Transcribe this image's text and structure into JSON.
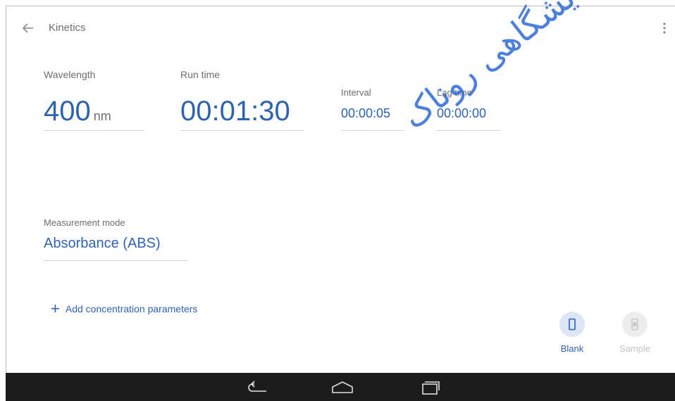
{
  "header": {
    "title": "Kinetics"
  },
  "fields": {
    "wavelength": {
      "label": "Wavelength",
      "value": "400",
      "unit": "nm"
    },
    "run_time": {
      "label": "Run time",
      "value": "00:01:30"
    },
    "interval": {
      "label": "Interval",
      "value": "00:00:05"
    },
    "lag_time": {
      "label": "Lag time",
      "value": "00:00:00"
    },
    "measurement_mode": {
      "label": "Measurement mode",
      "value": "Absorbance (ABS)"
    }
  },
  "add_concentration": {
    "label": "Add concentration parameters"
  },
  "actions": {
    "blank_label": "Blank",
    "sample_label": "Sample"
  },
  "icons": {
    "back": "arrow-left-icon",
    "overflow": "more-vert-icon",
    "add": "plus-icon",
    "blank": "cuvette-icon",
    "sample": "cuvette-icon",
    "nav_back": "nav-back-icon",
    "nav_home": "nav-home-icon",
    "nav_recent": "nav-recents-icon"
  },
  "colors": {
    "accent": "#2f62b0",
    "blank_bg": "#dce6f6",
    "sample_bg": "#ededed",
    "navbar": "#1c1c1c"
  },
  "watermark": {
    "text": "مرکز آزمایشگاهی روناک"
  }
}
